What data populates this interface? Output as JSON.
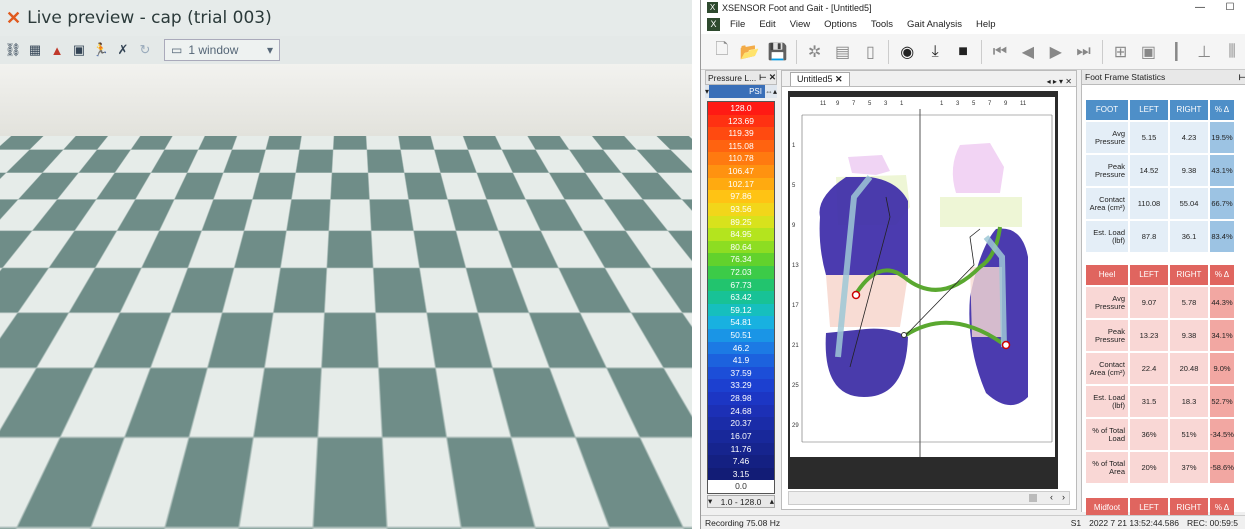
{
  "live_preview": {
    "title": "Live preview - cap (trial 003)",
    "window_select": "1 window",
    "colors": {
      "tile_dark": "#6f8d88",
      "tile_light": "#e6ece9"
    }
  },
  "app": {
    "window_title": "XSENSOR Foot and Gait - [Untitled5]",
    "menu": [
      "File",
      "Edit",
      "View",
      "Options",
      "Tools",
      "Gait Analysis",
      "Help"
    ]
  },
  "legend": {
    "panel_title": "Pressure L...",
    "units": "PSI",
    "levels": [
      {
        "v": "128.0",
        "c": "#ff1a14"
      },
      {
        "v": "123.69",
        "c": "#ff3112"
      },
      {
        "v": "119.39",
        "c": "#ff4a10"
      },
      {
        "v": "115.08",
        "c": "#ff6310"
      },
      {
        "v": "110.78",
        "c": "#ff7a10"
      },
      {
        "v": "106.47",
        "c": "#ff9210"
      },
      {
        "v": "102.17",
        "c": "#ffaa10"
      },
      {
        "v": "97.86",
        "c": "#ffc314"
      },
      {
        "v": "93.56",
        "c": "#f2d61a"
      },
      {
        "v": "89.25",
        "c": "#d8e21c"
      },
      {
        "v": "84.95",
        "c": "#b4e41e"
      },
      {
        "v": "80.64",
        "c": "#8ddd22"
      },
      {
        "v": "76.34",
        "c": "#62d22c"
      },
      {
        "v": "72.03",
        "c": "#3ccb48"
      },
      {
        "v": "67.73",
        "c": "#22c46e"
      },
      {
        "v": "63.42",
        "c": "#18c296"
      },
      {
        "v": "59.12",
        "c": "#16bfbe"
      },
      {
        "v": "54.81",
        "c": "#18b1e0"
      },
      {
        "v": "50.51",
        "c": "#1a95e6"
      },
      {
        "v": "46.2",
        "c": "#1c7ae4"
      },
      {
        "v": "41.9",
        "c": "#1c62de"
      },
      {
        "v": "37.59",
        "c": "#1c4ed8"
      },
      {
        "v": "33.29",
        "c": "#1c40d0"
      },
      {
        "v": "28.98",
        "c": "#1c36c4"
      },
      {
        "v": "24.68",
        "c": "#1c30b6"
      },
      {
        "v": "20.37",
        "c": "#1a2ca8"
      },
      {
        "v": "16.07",
        "c": "#18289a"
      },
      {
        "v": "11.76",
        "c": "#16248e"
      },
      {
        "v": "7.46",
        "c": "#142082"
      },
      {
        "v": "3.15",
        "c": "#121c76"
      },
      {
        "v": "0.0",
        "c": "#ffffff"
      }
    ],
    "range": "1.0 - 128.0"
  },
  "document": {
    "tab_label": "Untitled5",
    "top_ruler_left": [
      "11",
      "9",
      "7",
      "5",
      "3",
      "1"
    ],
    "top_ruler_right": [
      "1",
      "3",
      "5",
      "7",
      "9",
      "11"
    ],
    "side_ruler": [
      "1",
      "5",
      "9",
      "13",
      "17",
      "21",
      "25",
      "29"
    ]
  },
  "stats": {
    "panel_title": "Foot Frame Statistics",
    "foot": {
      "header": [
        "FOOT",
        "LEFT",
        "RIGHT",
        "% Δ"
      ],
      "rows": [
        {
          "label": "Avg Pressure",
          "left": "5.15",
          "right": "4.23",
          "pct": "19.5%"
        },
        {
          "label": "Peak Pressure",
          "left": "14.52",
          "right": "9.38",
          "pct": "43.1%"
        },
        {
          "label": "Contact Area (cm²)",
          "left": "110.08",
          "right": "55.04",
          "pct": "66.7%"
        },
        {
          "label": "Est. Load (lbf)",
          "left": "87.8",
          "right": "36.1",
          "pct": "83.4%"
        }
      ]
    },
    "heel": {
      "header": [
        "Heel",
        "LEFT",
        "RIGHT",
        "% Δ"
      ],
      "rows": [
        {
          "label": "Avg Pressure",
          "left": "9.07",
          "right": "5.78",
          "pct": "44.3%"
        },
        {
          "label": "Peak Pressure",
          "left": "13.23",
          "right": "9.38",
          "pct": "34.1%"
        },
        {
          "label": "Contact Area (cm²)",
          "left": "22.4",
          "right": "20.48",
          "pct": "9.0%"
        },
        {
          "label": "Est. Load (lbf)",
          "left": "31.5",
          "right": "18.3",
          "pct": "52.7%"
        },
        {
          "label": "% of Total Load",
          "left": "36%",
          "right": "51%",
          "pct": "-34.5%"
        },
        {
          "label": "% of Total Area",
          "left": "20%",
          "right": "37%",
          "pct": "-58.6%"
        }
      ]
    },
    "midfoot": {
      "header": [
        "Midfoot",
        "LEFT",
        "RIGHT",
        "% Δ"
      ]
    }
  },
  "status": {
    "recording": "Recording 75.08 Hz",
    "sensor": "S1",
    "timestamp": "2022 7 21    13:52:44.586",
    "rec": "REC: 00:59:5"
  }
}
